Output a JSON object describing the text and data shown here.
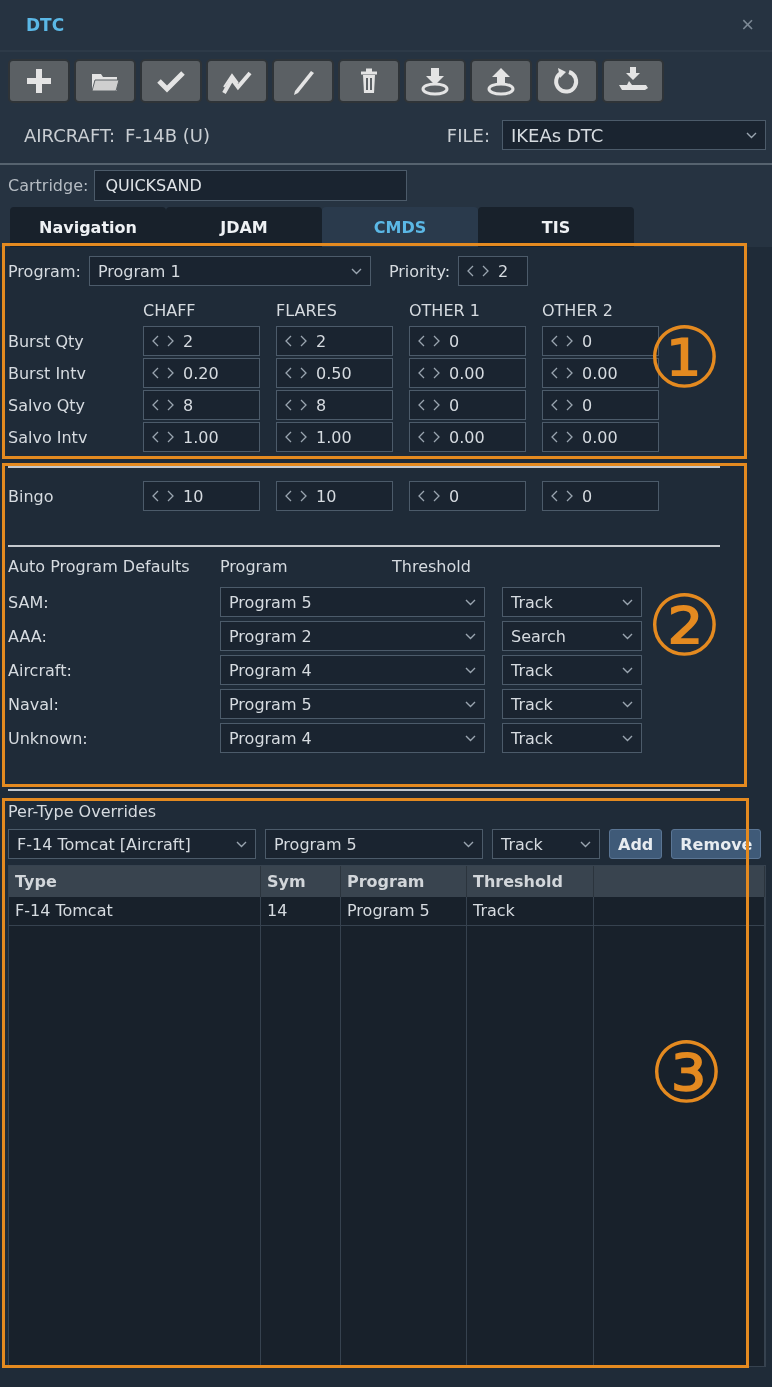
{
  "window": {
    "title": "DTC",
    "close": "×"
  },
  "aircraft": {
    "label": "AIRCRAFT:",
    "value": "F-14B (U)"
  },
  "file": {
    "label": "FILE:",
    "value": "IKEAs DTC"
  },
  "cartridge": {
    "label": "Cartridge:",
    "value": "QUICKSAND"
  },
  "tabs": [
    {
      "label": "Navigation",
      "selected": false
    },
    {
      "label": "JDAM",
      "selected": false
    },
    {
      "label": "CMDS",
      "selected": true
    },
    {
      "label": "TIS",
      "selected": false
    }
  ],
  "program": {
    "label": "Program:",
    "value": "Program 1",
    "priority_label": "Priority:",
    "priority": "2"
  },
  "columns": [
    "CHAFF",
    "FLARES",
    "OTHER 1",
    "OTHER 2"
  ],
  "rows": [
    {
      "label": "Burst Qty",
      "values": [
        "2",
        "2",
        "0",
        "0"
      ]
    },
    {
      "label": "Burst Intv",
      "values": [
        "0.20",
        "0.50",
        "0.00",
        "0.00"
      ]
    },
    {
      "label": "Salvo Qty",
      "values": [
        "8",
        "8",
        "0",
        "0"
      ]
    },
    {
      "label": "Salvo Intv",
      "values": [
        "1.00",
        "1.00",
        "0.00",
        "0.00"
      ]
    }
  ],
  "bingo": {
    "label": "Bingo",
    "values": [
      "10",
      "10",
      "0",
      "0"
    ]
  },
  "auto_defaults": {
    "headers": [
      "Auto Program Defaults",
      "Program",
      "Threshold"
    ],
    "rows": [
      {
        "label": "SAM:",
        "program": "Program 5",
        "threshold": "Track"
      },
      {
        "label": "AAA:",
        "program": "Program 2",
        "threshold": "Search"
      },
      {
        "label": "Aircraft:",
        "program": "Program 4",
        "threshold": "Track"
      },
      {
        "label": "Naval:",
        "program": "Program 5",
        "threshold": "Track"
      },
      {
        "label": "Unknown:",
        "program": "Program 4",
        "threshold": "Track"
      }
    ]
  },
  "overrides": {
    "title": "Per-Type Overrides",
    "type": "F-14 Tomcat [Aircraft]",
    "program": "Program 5",
    "threshold": "Track",
    "buttons": [
      "Add",
      "Remove"
    ],
    "table": {
      "columns": [
        "Type",
        "Sym",
        "Program",
        "Threshold"
      ],
      "rows": [
        [
          "F-14 Tomcat",
          "14",
          "Program 5",
          "Track"
        ]
      ]
    }
  },
  "callouts": [
    "①",
    "②",
    "③"
  ]
}
